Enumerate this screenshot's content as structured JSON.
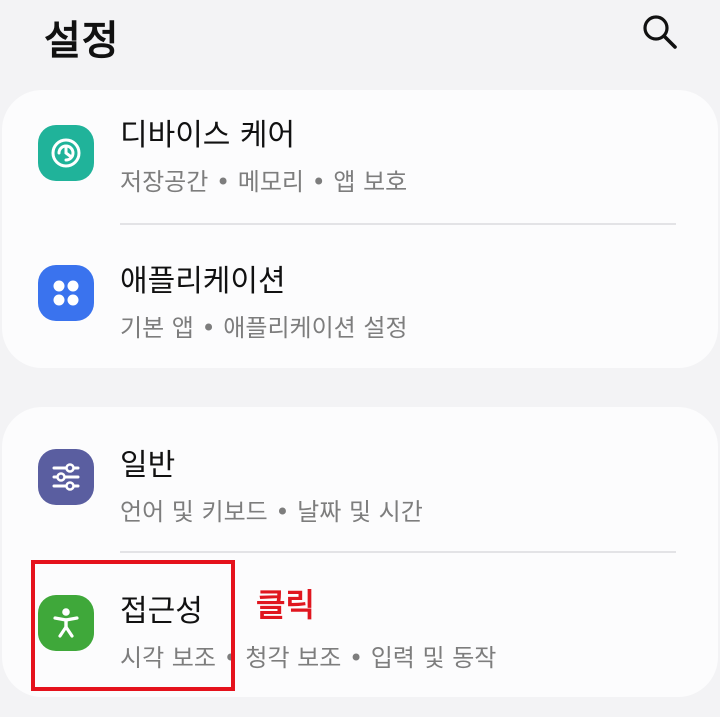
{
  "header": {
    "title": "설정"
  },
  "groups": [
    {
      "items": [
        {
          "title": "디바이스 케어",
          "subtitle": "저장공간  •  메모리  •  앱 보호",
          "icon": "device-care-icon",
          "color": "#20b39a"
        },
        {
          "title": "애플리케이션",
          "subtitle": "기본 앱  •  애플리케이션 설정",
          "icon": "apps-grid-icon",
          "color": "#3a73ee"
        }
      ]
    },
    {
      "items": [
        {
          "title": "일반",
          "subtitle": "언어 및 키보드  •  날짜 및 시간",
          "icon": "sliders-icon",
          "color": "#5a5ea0"
        },
        {
          "title": "접근성",
          "subtitle": "시각 보조  •  청각 보조  •  입력 및 동작",
          "icon": "accessibility-icon",
          "color": "#3fa83a"
        }
      ]
    }
  ],
  "annotation": {
    "label": "클릭",
    "color": "#e5121c"
  }
}
